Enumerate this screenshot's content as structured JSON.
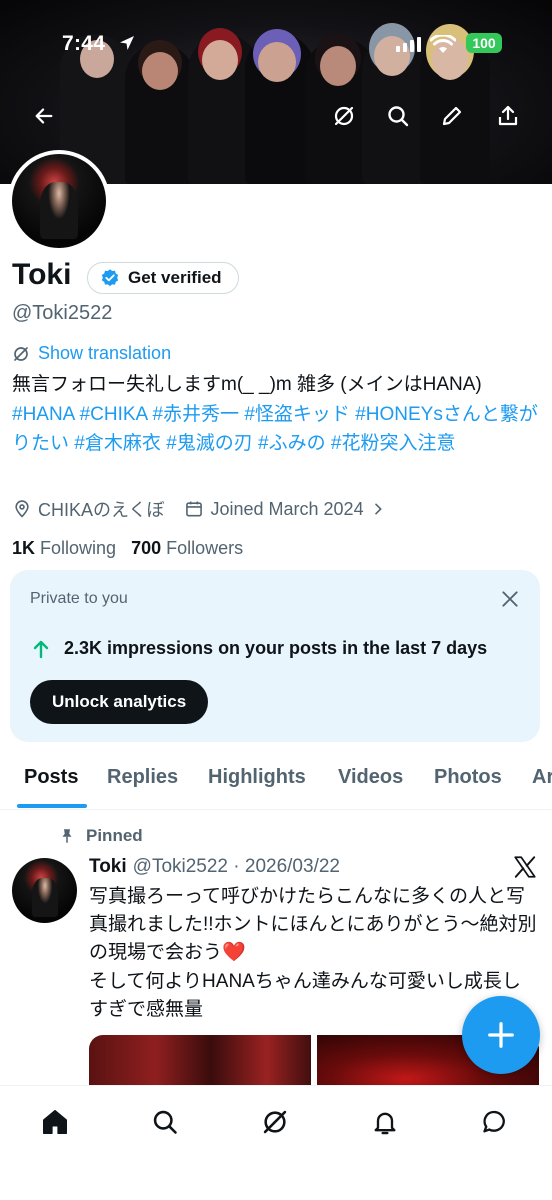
{
  "status_bar": {
    "time": "7:44",
    "battery": "100"
  },
  "header": {
    "icons": [
      "back-arrow-icon",
      "grok-icon",
      "search-icon",
      "edit-pencil-icon",
      "share-icon"
    ]
  },
  "profile": {
    "name": "Toki",
    "verify_label": "Get verified",
    "handle": "@Toki2522",
    "translate_label": "Show translation",
    "bio_text": "無言フォロー失礼しますm(_ _)m 雑多 (メインはHANA)",
    "bio_tags": [
      "#HANA",
      "#CHIKA",
      "#赤井秀一",
      "#怪盗キッド",
      "#HONEYsさんと繋がりたい",
      "#倉木麻衣",
      "#鬼滅の刃",
      "#ふみの",
      "#花粉突入注意"
    ],
    "location": "CHIKAのえくぼ",
    "joined": "Joined March 2024",
    "following_count": "1K",
    "following_label": "Following",
    "followers_count": "700",
    "followers_label": "Followers"
  },
  "private_card": {
    "label": "Private to you",
    "impressions": "2.3K impressions on your posts in the last 7 days",
    "button": "Unlock analytics"
  },
  "tabs": [
    "Posts",
    "Replies",
    "Highlights",
    "Videos",
    "Photos",
    "Ar"
  ],
  "active_tab": "Posts",
  "pinned_post": {
    "pinned_label": "Pinned",
    "name": "Toki",
    "meta": "@Toki2522 · 2026/03/22",
    "text_line1": "写真撮ろーって呼びかけたらこんなに多くの人と写真撮れました!!ホントにほんとにありがとう〜絶対別の現場で会おう",
    "text_heart": "❤️",
    "text_line2": "そして何よりHANAちゃん達みんな可愛いし成長しすぎで感無量"
  },
  "colors": {
    "accent": "#1d9bf0",
    "card_bg": "#e8f5fd",
    "battery": "#34c759"
  },
  "bottom_nav": [
    "home-icon",
    "search-icon",
    "grok-icon",
    "notifications-bell-icon",
    "messages-icon"
  ]
}
